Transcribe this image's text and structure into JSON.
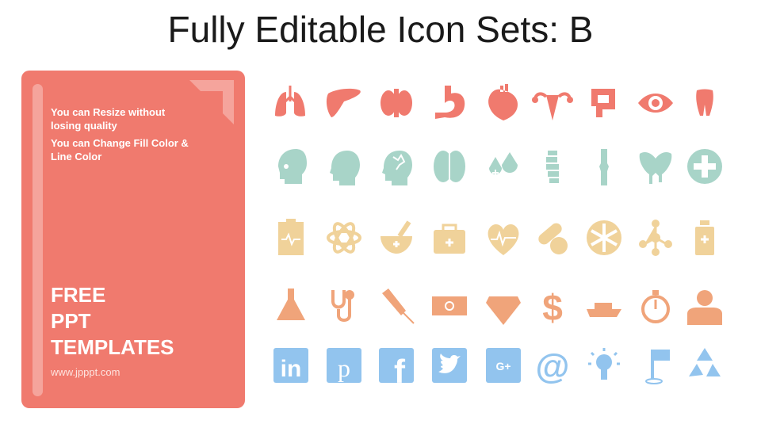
{
  "title": "Fully Editable Icon Sets: B",
  "card": {
    "line1": "You can Resize without losing quality",
    "line2": "You can Change Fill Color & Line Color",
    "headline": [
      "FREE",
      "PPT",
      "TEMPLATES"
    ],
    "url": "www.jpppt.com",
    "color": "#f07a6e"
  },
  "icon_rows": [
    {
      "color": "#f07a6e",
      "icons": [
        "lungs-icon",
        "liver-icon",
        "kidneys-icon",
        "stomach-icon",
        "heart-organ-icon",
        "uterus-icon",
        "intestine-icon",
        "eye-icon",
        "tooth-icon"
      ]
    },
    {
      "color": "#a8d4c8",
      "icons": [
        "skull-icon",
        "head-icon",
        "brain-head-icon",
        "brain-icon",
        "blood-drops-icon",
        "spine-icon",
        "knee-bone-icon",
        "pelvis-icon",
        "medical-cross-icon"
      ]
    },
    {
      "color": "#f0d29a",
      "icons": [
        "clipboard-ecg-icon",
        "atom-icon",
        "mortar-pestle-icon",
        "first-aid-kit-icon",
        "heart-ecg-icon",
        "pills-icon",
        "asterisk-circle-icon",
        "molecule-icon",
        "medicine-bottle-icon"
      ]
    },
    {
      "color": "#f0a47a",
      "icons": [
        "flask-icon",
        "stethoscope-icon",
        "syringe-icon",
        "banknote-icon",
        "diamond-icon",
        "dollar-icon",
        "ship-icon",
        "stopwatch-icon",
        "user-icon"
      ]
    },
    {
      "color": "#92c4ee",
      "icons": [
        "linkedin-icon",
        "pinterest-icon",
        "facebook-icon",
        "twitter-icon",
        "google-plus-icon",
        "at-sign-icon",
        "lightbulb-icon",
        "golf-flag-icon",
        "recycle-icon"
      ]
    }
  ]
}
